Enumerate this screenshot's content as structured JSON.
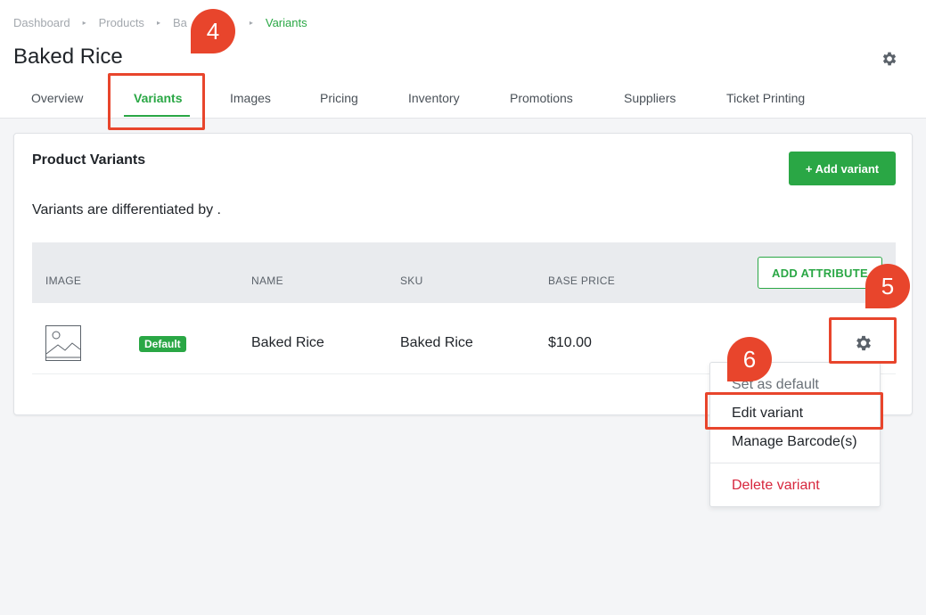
{
  "breadcrumb": {
    "items": [
      "Dashboard",
      "Products",
      "Ba",
      "Variants"
    ]
  },
  "page": {
    "title": "Baked Rice"
  },
  "tabs": [
    "Overview",
    "Variants",
    "Images",
    "Pricing",
    "Inventory",
    "Promotions",
    "Suppliers",
    "Ticket Printing"
  ],
  "active_tab": "Variants",
  "card": {
    "title": "Product Variants",
    "add_variant_label": "+ Add variant",
    "description": "Variants are differentiated by ."
  },
  "table": {
    "headers": {
      "image": "IMAGE",
      "name": "NAME",
      "sku": "SKU",
      "base_price": "BASE PRICE"
    },
    "add_attribute_label": "ADD ATTRIBUTE",
    "rows": [
      {
        "badge": "Default",
        "name": "Baked Rice",
        "sku": "Baked Rice",
        "base_price": "$10.00"
      }
    ]
  },
  "menu": {
    "set_default": "Set as default",
    "edit_variant": "Edit variant",
    "manage_barcodes": "Manage Barcode(s)",
    "delete_variant": "Delete variant"
  },
  "markers": [
    "4",
    "5",
    "6"
  ],
  "colors": {
    "accent": "#2aa745",
    "danger": "#d7263d",
    "highlight": "#e8452c"
  },
  "icons": {
    "page_settings": "gear-icon",
    "row_settings": "gear-icon",
    "image_placeholder": "image-placeholder-icon",
    "breadcrumb_separator": "triangle-right-icon"
  }
}
